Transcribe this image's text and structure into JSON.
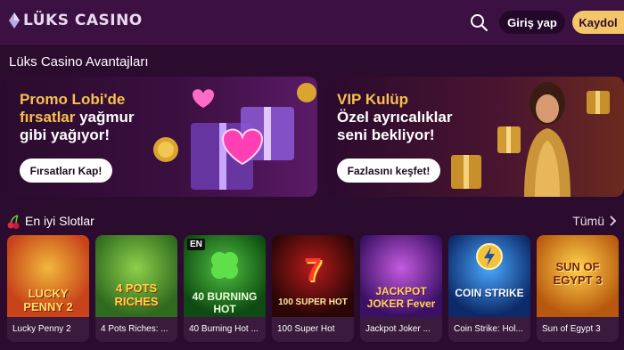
{
  "header": {
    "logo_text": "LÜKS CASINO",
    "login_label": "Giriş yap",
    "register_label": "Kaydol"
  },
  "section_title": "Lüks Casino Avantajları",
  "banners": [
    {
      "title_line1": "Promo Lobi'de",
      "title_line2_gold": "fırsatlar ",
      "title_line2_white": "yağmur",
      "title_line3": "gibi yağıyor!",
      "button": "Fırsatları Kap!"
    },
    {
      "title_line1": "VIP Kulüp",
      "title_line2": "Özel ayrıcalıklar",
      "title_line3": "seni bekliyor!",
      "button": "Fazlasını keşfet!"
    }
  ],
  "slots_section": {
    "title": "En iyi Slotlar",
    "all_label": "Tümü"
  },
  "slots": [
    {
      "name": "Lucky Penny 2",
      "art_text": "LUCKY PENNY 2",
      "color": "#c8431a"
    },
    {
      "name": "4 Pots Riches: ...",
      "art_text": "4 POTS RICHES",
      "color": "#4b8a2a"
    },
    {
      "name": "40 Burning Hot ...",
      "art_text": "40 BURNING HOT",
      "badge": "EN",
      "color": "#1d7a1f"
    },
    {
      "name": "100 Super Hot",
      "art_text": "100 SUPER HOT",
      "color": "#5a1010"
    },
    {
      "name": "Jackpot Joker ...",
      "art_text": "JACKPOT JOKER Fever",
      "color": "#7a2a9a"
    },
    {
      "name": "Coin Strike: Hol...",
      "art_text": "COIN STRIKE",
      "color": "#1b4fa8"
    },
    {
      "name": "Sun of Egypt 3",
      "art_text": "SUN OF EGYPT 3",
      "color": "#e0a21a"
    }
  ],
  "colors": {
    "background": "#2b0b2e",
    "header": "#3a1140",
    "accent_gold": "#f4c669",
    "banner_gold_text": "#f6c14c"
  }
}
